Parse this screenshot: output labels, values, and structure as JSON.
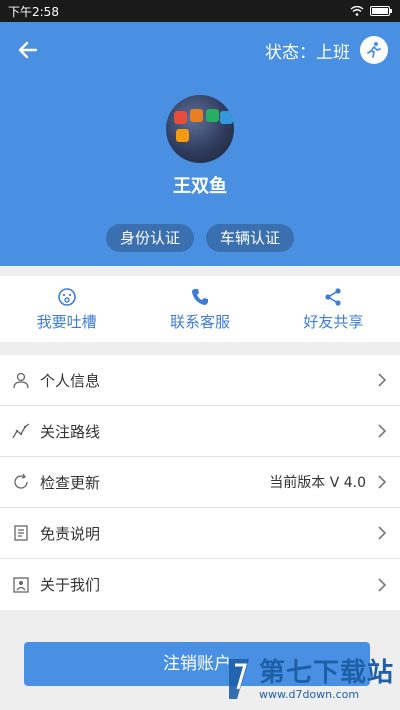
{
  "statusbar": {
    "time": "下午2:58"
  },
  "header": {
    "status": "状态：上班",
    "user_name": "王双鱼",
    "tags": [
      "身份认证",
      "车辆认证"
    ]
  },
  "quick_actions": [
    {
      "label": "我要吐槽",
      "icon": "face-icon"
    },
    {
      "label": "联系客服",
      "icon": "phone-icon"
    },
    {
      "label": "好友共享",
      "icon": "share-icon"
    }
  ],
  "menu": [
    {
      "label": "个人信息",
      "icon": "person-icon"
    },
    {
      "label": "关注路线",
      "icon": "route-icon"
    },
    {
      "label": "检查更新",
      "icon": "refresh-icon",
      "extra": "当前版本  V 4.0"
    },
    {
      "label": "免责说明",
      "icon": "document-icon"
    },
    {
      "label": "关于我们",
      "icon": "about-icon"
    }
  ],
  "logout_label": "注销账户",
  "watermark": {
    "brand": "第七下载站",
    "url": "www.d7down.com"
  },
  "colors": {
    "primary": "#4a90e2",
    "accent_text": "#3d7dd8"
  }
}
